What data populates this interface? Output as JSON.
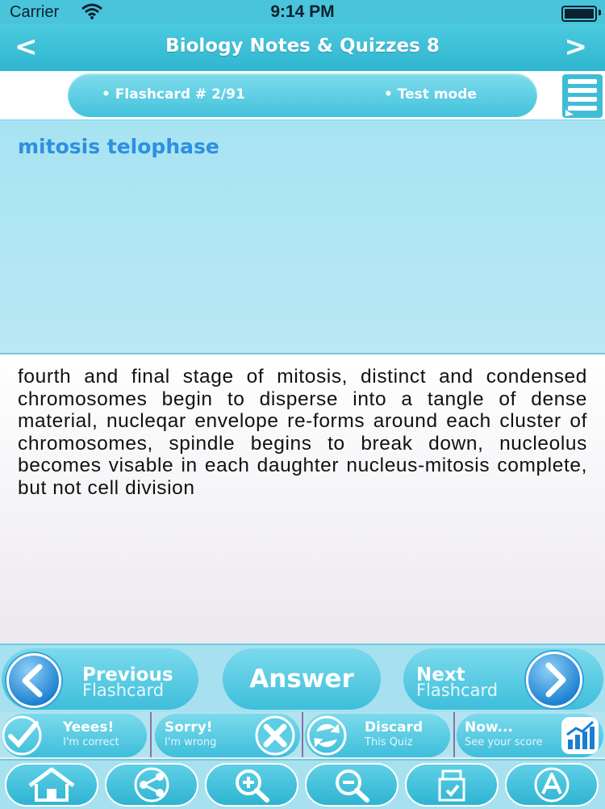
{
  "status_bar": {
    "carrier": "Carrier",
    "time": "9:14 PM"
  },
  "nav": {
    "title": "Biology Notes & Quizzes 8",
    "back_label": "<",
    "forward_label": ">"
  },
  "info": {
    "flashcard_label": "• Flashcard #  2/91",
    "mode_label": "• Test mode"
  },
  "question": {
    "text": "mitosis telophase"
  },
  "answer": {
    "text": "fourth and final stage of mitosis, distinct and condensed chromosomes begin to disperse into a tangle of dense material, nucleqar envelope re-forms around each cluster of chromosomes, spindle begins to break down, nucleolus becomes visable in each daughter nucleus-mitosis complete, but not cell division"
  },
  "controls": {
    "previous": {
      "label": "Previous",
      "sub": "Flashcard"
    },
    "answer_label": "Answer",
    "next": {
      "label": "Next",
      "sub": "Flashcard"
    }
  },
  "actions": [
    {
      "label": "Yeees!",
      "sub": "I'm correct"
    },
    {
      "label": "Sorry!",
      "sub": "I'm wrong"
    },
    {
      "label": "Discard",
      "sub": "This Quiz"
    },
    {
      "label": "Now...",
      "sub": "See your score"
    }
  ],
  "toolbar_icons": [
    "home-icon",
    "share-icon",
    "zoom-in-icon",
    "zoom-out-icon",
    "bookmark-icon",
    "font-size-icon"
  ],
  "colors": {
    "accent": "#3ebedb",
    "question_text": "#2e8fe0",
    "nav_bg": "#2fb6d0"
  }
}
